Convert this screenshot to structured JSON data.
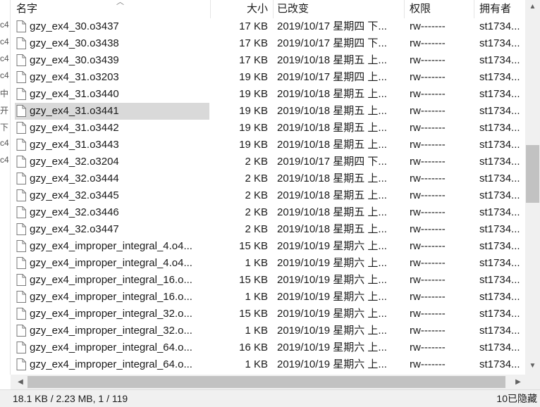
{
  "columns": {
    "name": "名字",
    "size": "大小",
    "modified": "已改变",
    "permissions": "权限",
    "owner": "拥有者"
  },
  "left_strip_glyphs": [
    "c4",
    "c4",
    "c4",
    "c4",
    "中",
    "开",
    "下",
    "c4",
    "c4"
  ],
  "files": [
    {
      "name": "gzy_ex4_30.o3437",
      "size": "17 KB",
      "modified": "2019/10/17 星期四 下...",
      "permissions": "rw-------",
      "owner": "st1734..."
    },
    {
      "name": "gzy_ex4_30.o3438",
      "size": "17 KB",
      "modified": "2019/10/17 星期四 下...",
      "permissions": "rw-------",
      "owner": "st1734..."
    },
    {
      "name": "gzy_ex4_30.o3439",
      "size": "17 KB",
      "modified": "2019/10/18 星期五 上...",
      "permissions": "rw-------",
      "owner": "st1734..."
    },
    {
      "name": "gzy_ex4_31.o3203",
      "size": "19 KB",
      "modified": "2019/10/17 星期四 上...",
      "permissions": "rw-------",
      "owner": "st1734..."
    },
    {
      "name": "gzy_ex4_31.o3440",
      "size": "19 KB",
      "modified": "2019/10/18 星期五 上...",
      "permissions": "rw-------",
      "owner": "st1734..."
    },
    {
      "name": "gzy_ex4_31.o3441",
      "size": "19 KB",
      "modified": "2019/10/18 星期五 上...",
      "permissions": "rw-------",
      "owner": "st1734..."
    },
    {
      "name": "gzy_ex4_31.o3442",
      "size": "19 KB",
      "modified": "2019/10/18 星期五 上...",
      "permissions": "rw-------",
      "owner": "st1734..."
    },
    {
      "name": "gzy_ex4_31.o3443",
      "size": "19 KB",
      "modified": "2019/10/18 星期五 上...",
      "permissions": "rw-------",
      "owner": "st1734..."
    },
    {
      "name": "gzy_ex4_32.o3204",
      "size": "2 KB",
      "modified": "2019/10/17 星期四 下...",
      "permissions": "rw-------",
      "owner": "st1734..."
    },
    {
      "name": "gzy_ex4_32.o3444",
      "size": "2 KB",
      "modified": "2019/10/18 星期五 上...",
      "permissions": "rw-------",
      "owner": "st1734..."
    },
    {
      "name": "gzy_ex4_32.o3445",
      "size": "2 KB",
      "modified": "2019/10/18 星期五 上...",
      "permissions": "rw-------",
      "owner": "st1734..."
    },
    {
      "name": "gzy_ex4_32.o3446",
      "size": "2 KB",
      "modified": "2019/10/18 星期五 上...",
      "permissions": "rw-------",
      "owner": "st1734..."
    },
    {
      "name": "gzy_ex4_32.o3447",
      "size": "2 KB",
      "modified": "2019/10/18 星期五 上...",
      "permissions": "rw-------",
      "owner": "st1734..."
    },
    {
      "name": "gzy_ex4_improper_integral_4.o4...",
      "size": "15 KB",
      "modified": "2019/10/19 星期六 上...",
      "permissions": "rw-------",
      "owner": "st1734..."
    },
    {
      "name": "gzy_ex4_improper_integral_4.o4...",
      "size": "1 KB",
      "modified": "2019/10/19 星期六 上...",
      "permissions": "rw-------",
      "owner": "st1734..."
    },
    {
      "name": "gzy_ex4_improper_integral_16.o...",
      "size": "15 KB",
      "modified": "2019/10/19 星期六 上...",
      "permissions": "rw-------",
      "owner": "st1734..."
    },
    {
      "name": "gzy_ex4_improper_integral_16.o...",
      "size": "1 KB",
      "modified": "2019/10/19 星期六 上...",
      "permissions": "rw-------",
      "owner": "st1734..."
    },
    {
      "name": "gzy_ex4_improper_integral_32.o...",
      "size": "15 KB",
      "modified": "2019/10/19 星期六 上...",
      "permissions": "rw-------",
      "owner": "st1734..."
    },
    {
      "name": "gzy_ex4_improper_integral_32.o...",
      "size": "1 KB",
      "modified": "2019/10/19 星期六 上...",
      "permissions": "rw-------",
      "owner": "st1734..."
    },
    {
      "name": "gzy_ex4_improper_integral_64.o...",
      "size": "16 KB",
      "modified": "2019/10/19 星期六 上...",
      "permissions": "rw-------",
      "owner": "st1734..."
    },
    {
      "name": "gzy_ex4_improper_integral_64.o...",
      "size": "1 KB",
      "modified": "2019/10/19 星期六 上...",
      "permissions": "rw-------",
      "owner": "st1734..."
    }
  ],
  "selected_index": 5,
  "status": {
    "selection": "18.1 KB / 2.23 MB,   1 / 119",
    "hidden": "10已隐藏"
  },
  "icons": {
    "file": "document-icon",
    "sort": "sort-ascending-icon"
  },
  "colors": {
    "selected_row": "#d9d9d9",
    "background": "#ffffff",
    "chrome": "#f0f0f0"
  }
}
